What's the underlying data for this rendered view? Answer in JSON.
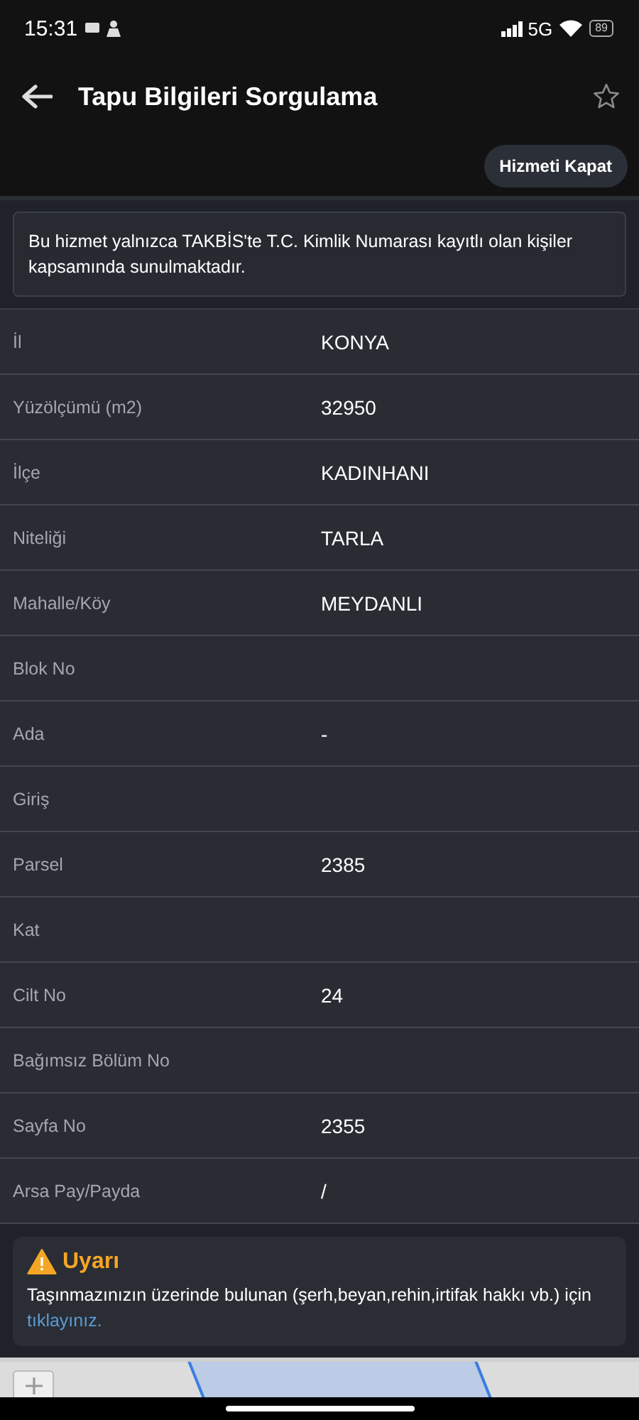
{
  "status_bar": {
    "time": "15:31",
    "network": "5G",
    "battery": "89"
  },
  "header": {
    "title": "Tapu Bilgileri Sorgulama",
    "favorite": false
  },
  "close_service_button": "Hizmeti Kapat",
  "notice": "Bu hizmet yalnızca TAKBİS'te T.C. Kimlik Numarası kayıtlı olan kişiler kapsamında sunulmaktadır.",
  "details": [
    {
      "label": "İl",
      "value": "KONYA"
    },
    {
      "label": "Yüzölçümü (m2)",
      "value": "32950"
    },
    {
      "label": "İlçe",
      "value": "KADINHANI"
    },
    {
      "label": "Niteliği",
      "value": "TARLA"
    },
    {
      "label": "Mahalle/Köy",
      "value": "MEYDANLI"
    },
    {
      "label": "Blok No"
    },
    {
      "label": "Ada",
      "value": "-"
    },
    {
      "label": "Giriş"
    },
    {
      "label": "Parsel",
      "value": "2385"
    },
    {
      "label": "Kat"
    },
    {
      "label": "Cilt No",
      "value": "24"
    },
    {
      "label": "Bağımsız Bölüm No"
    },
    {
      "label": "Sayfa No",
      "value": "2355"
    },
    {
      "label": "Arsa Pay/Payda",
      "value": "/"
    }
  ],
  "warning": {
    "title": "Uyarı",
    "text": "Taşınmazınızın üzerinde bulunan (şerh,beyan,rehin,irtifak hakkı vb.) için",
    "link": "tıklayınız."
  }
}
